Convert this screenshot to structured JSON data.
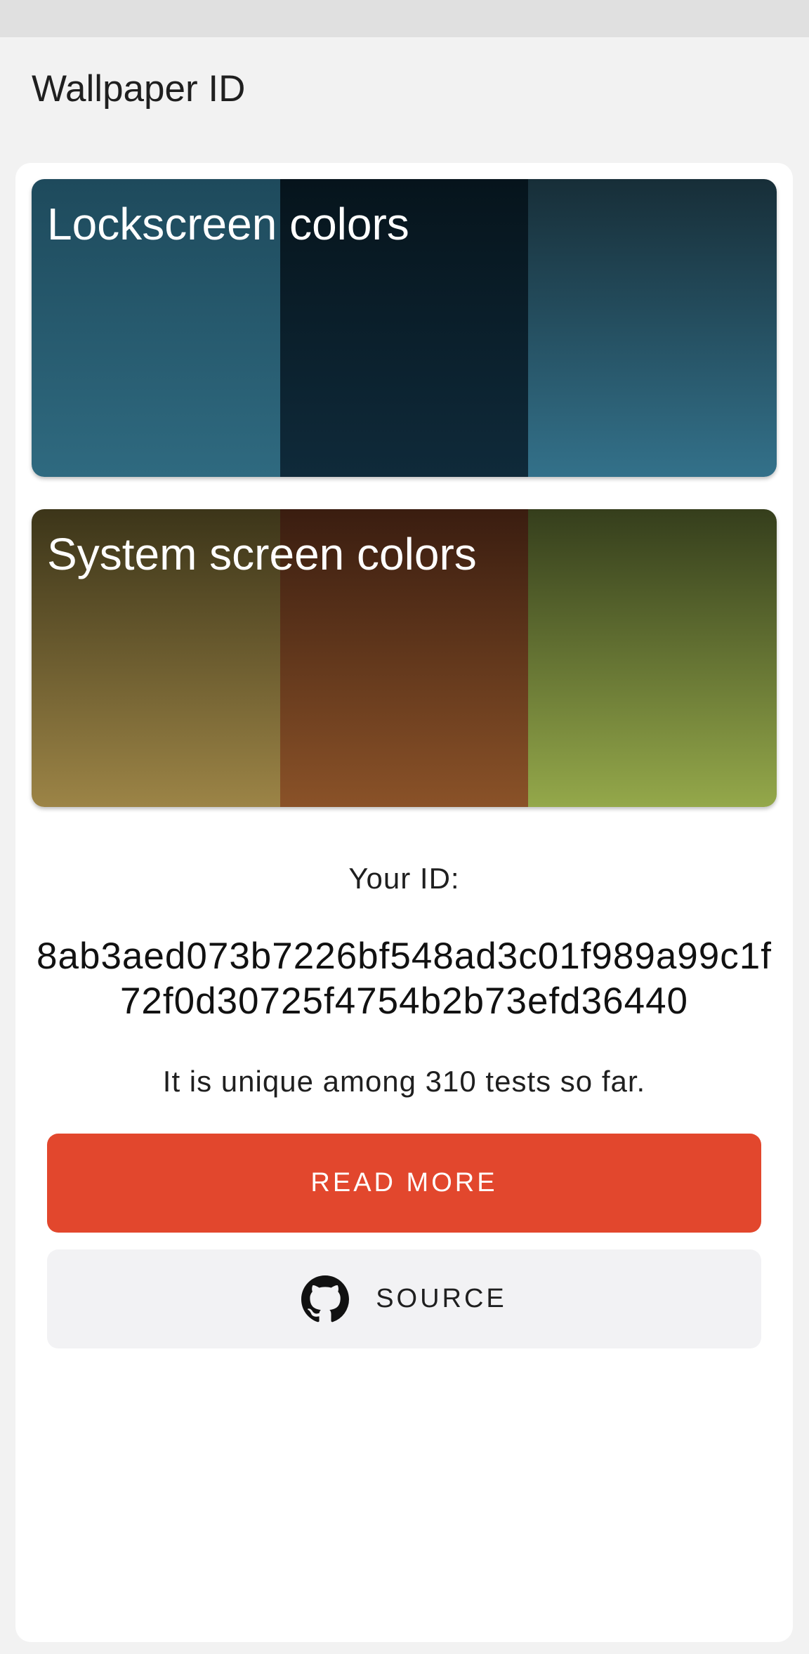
{
  "app": {
    "title": "Wallpaper ID"
  },
  "lockscreen": {
    "title": "Lockscreen colors",
    "colors": [
      {
        "top": "#1e4a5c",
        "bottom": "#2f6a80"
      },
      {
        "top": "#06141c",
        "bottom": "#0f2a3a"
      },
      {
        "top": "#172e38",
        "bottom": "#33718a"
      }
    ]
  },
  "system": {
    "title": "System screen colors",
    "colors": [
      {
        "top": "#3c3519",
        "bottom": "#9c8446"
      },
      {
        "top": "#3a1d10",
        "bottom": "#8a5228"
      },
      {
        "top": "#353e1c",
        "bottom": "#94a84a"
      }
    ]
  },
  "id_section": {
    "label": "Your ID:",
    "value": "8ab3aed073b7226bf548ad3c01f989a99c1f72f0d30725f4754b2b73efd36440",
    "unique_text": "It is unique among 310 tests so far."
  },
  "buttons": {
    "read_more": "READ MORE",
    "source": "SOURCE",
    "source_icon": "github-icon"
  },
  "colors": {
    "accent": "#e2472d",
    "source_button_bg": "#f2f2f4"
  }
}
